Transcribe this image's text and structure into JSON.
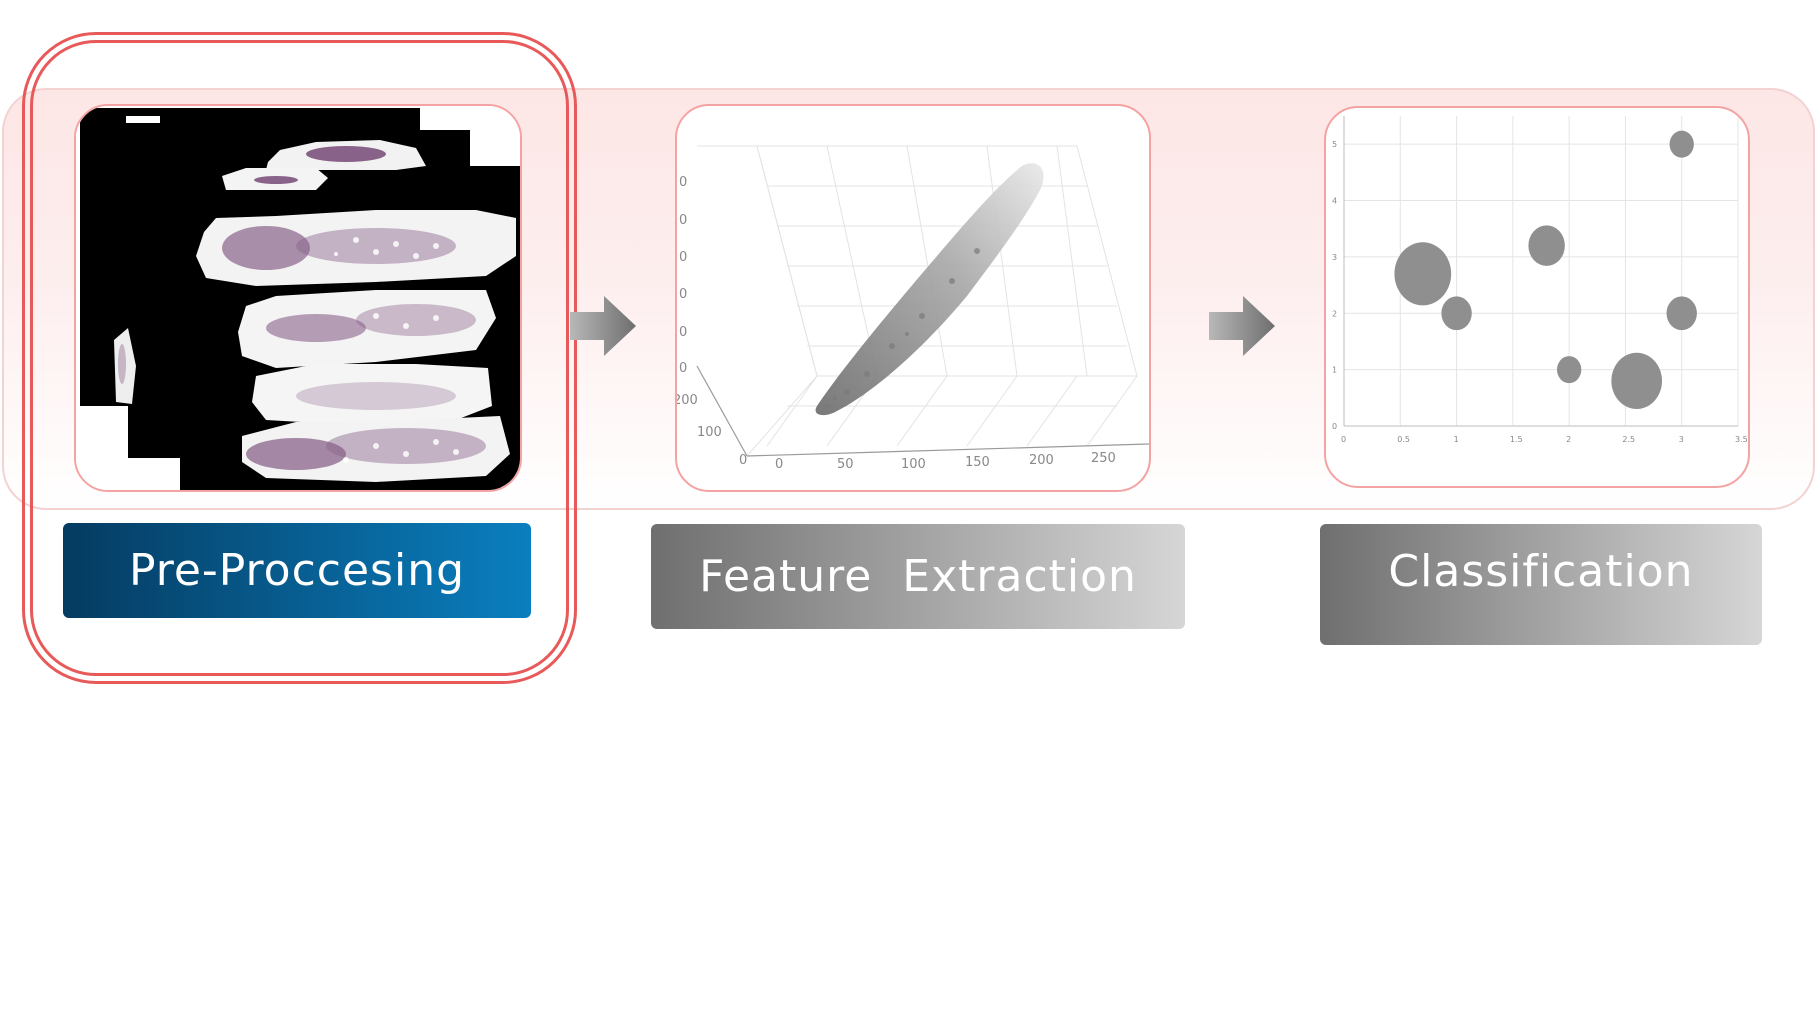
{
  "steps": [
    {
      "label": "Pre-Proccesing",
      "color_start": "#053b61",
      "color_end": "#0a7fbf"
    },
    {
      "label": "Feature  Extraction",
      "color_start": "#6f6f6f",
      "color_end": "#d6d6d6"
    },
    {
      "label": "Classification",
      "color_start": "#6f6f6f",
      "color_end": "#d6d6d6"
    }
  ],
  "feature_plot": {
    "x_ticks": [
      "0",
      "50",
      "100",
      "150",
      "200",
      "250"
    ],
    "y_ticks": [
      "0",
      "100",
      "200"
    ],
    "z_ticks": [
      "0",
      "0",
      "0",
      "0",
      "0",
      "0"
    ]
  },
  "classification_plot": {
    "x_ticks": [
      "0",
      "0.5",
      "1",
      "1.5",
      "2",
      "2.5",
      "3",
      "3.5"
    ],
    "y_ticks": [
      "0",
      "1",
      "2",
      "3",
      "4",
      "5"
    ]
  },
  "chart_data": {
    "type": "scatter",
    "title": "",
    "xlabel": "",
    "ylabel": "",
    "xlim": [
      0,
      3.5
    ],
    "ylim": [
      0,
      5.5
    ],
    "series": [
      {
        "x": [
          0.7,
          1.0,
          1.8,
          2.0,
          2.6,
          3.0,
          3.0
        ],
        "y": [
          2.7,
          2.0,
          3.2,
          1.0,
          0.8,
          2.0,
          5.0
        ],
        "size": [
          0.28,
          0.15,
          0.18,
          0.12,
          0.25,
          0.15,
          0.12
        ]
      }
    ]
  },
  "colors": {
    "highlight": "#e85a5a",
    "panel_border": "#f4a3a3",
    "bubble": "#8f8f8f"
  }
}
